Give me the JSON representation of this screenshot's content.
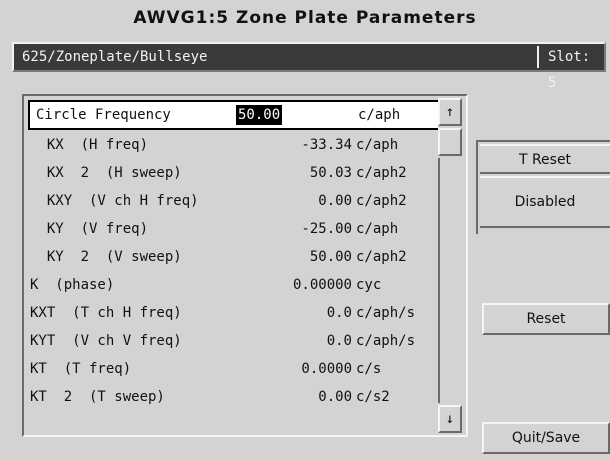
{
  "window": {
    "title": "AWVG1:5  Zone Plate Parameters"
  },
  "path": {
    "text": "625/Zoneplate/Bullseye",
    "slot": "Slot: 5"
  },
  "parameters": [
    {
      "name": "Circle Frequency",
      "value": "50.00",
      "unit": "c/aph",
      "selected": true
    },
    {
      "name": "  KX  (H freq)",
      "value": "-33.34",
      "unit": "c/aph"
    },
    {
      "name": "  KX  2  (H sweep)",
      "value": "50.03",
      "unit": "c/aph2"
    },
    {
      "name": "  KXY  (V ch H freq)",
      "value": "0.00",
      "unit": "c/aph2"
    },
    {
      "name": "  KY  (V freq)",
      "value": "-25.00",
      "unit": "c/aph"
    },
    {
      "name": "  KY  2  (V sweep)",
      "value": "50.00",
      "unit": "c/aph2"
    },
    {
      "name": "K  (phase)",
      "value": "0.00000",
      "unit": "cyc"
    },
    {
      "name": "KXT  (T ch H freq)",
      "value": "0.0",
      "unit": "c/aph/s"
    },
    {
      "name": "KYT  (V ch V freq)",
      "value": "0.0",
      "unit": "c/aph/s"
    },
    {
      "name": "KT  (T freq)",
      "value": "0.0000",
      "unit": "c/s"
    },
    {
      "name": "KT  2  (T sweep)",
      "value": "0.00",
      "unit": "c/s2"
    }
  ],
  "scrollbar": {
    "up_icon": "arrow-up-icon",
    "down_icon": "arrow-down-icon",
    "up_glyph": "↑",
    "down_glyph": "↓"
  },
  "t_reset": {
    "label": "T Reset",
    "value": "Disabled"
  },
  "buttons": {
    "reset": "Reset",
    "quit_save": "Quit/Save"
  }
}
